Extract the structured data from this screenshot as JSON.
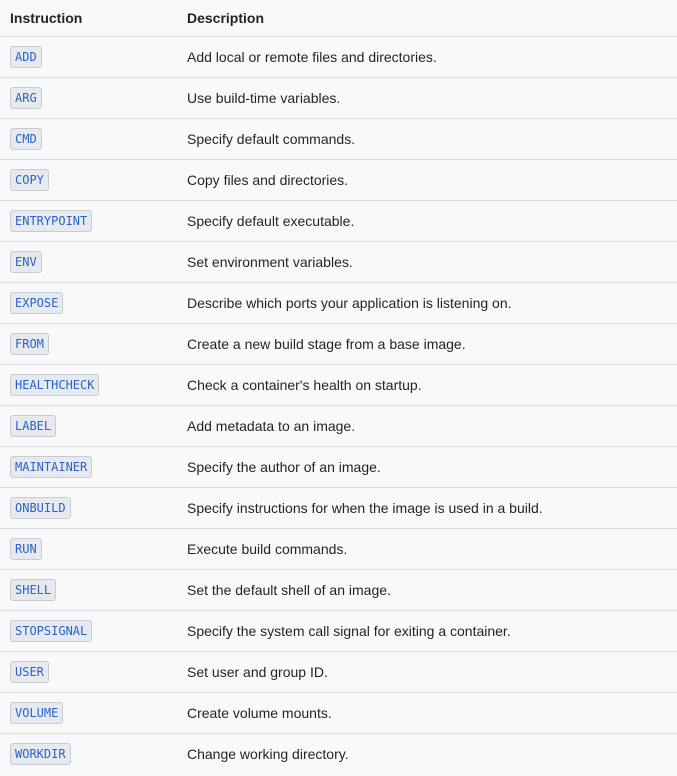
{
  "table": {
    "headers": {
      "instruction": "Instruction",
      "description": "Description"
    },
    "rows": [
      {
        "instruction": "ADD",
        "description": "Add local or remote files and directories."
      },
      {
        "instruction": "ARG",
        "description": "Use build-time variables."
      },
      {
        "instruction": "CMD",
        "description": "Specify default commands."
      },
      {
        "instruction": "COPY",
        "description": "Copy files and directories."
      },
      {
        "instruction": "ENTRYPOINT",
        "description": "Specify default executable."
      },
      {
        "instruction": "ENV",
        "description": "Set environment variables."
      },
      {
        "instruction": "EXPOSE",
        "description": "Describe which ports your application is listening on."
      },
      {
        "instruction": "FROM",
        "description": "Create a new build stage from a base image."
      },
      {
        "instruction": "HEALTHCHECK",
        "description": "Check a container's health on startup."
      },
      {
        "instruction": "LABEL",
        "description": "Add metadata to an image."
      },
      {
        "instruction": "MAINTAINER",
        "description": "Specify the author of an image."
      },
      {
        "instruction": "ONBUILD",
        "description": "Specify instructions for when the image is used in a build."
      },
      {
        "instruction": "RUN",
        "description": "Execute build commands."
      },
      {
        "instruction": "SHELL",
        "description": "Set the default shell of an image."
      },
      {
        "instruction": "STOPSIGNAL",
        "description": "Specify the system call signal for exiting a container."
      },
      {
        "instruction": "USER",
        "description": "Set user and group ID."
      },
      {
        "instruction": "VOLUME",
        "description": "Create volume mounts."
      },
      {
        "instruction": "WORKDIR",
        "description": "Change working directory."
      }
    ]
  },
  "colors": {
    "code_text": "#2a64c8",
    "code_background": "#e6e9ee",
    "page_background": "#f8f9fa",
    "divider": "#d9dce0"
  }
}
